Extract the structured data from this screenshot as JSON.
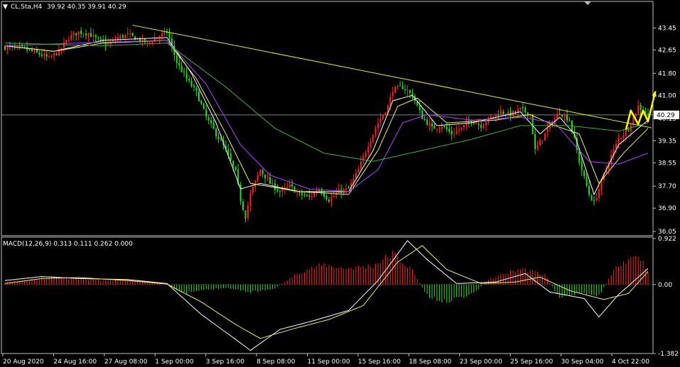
{
  "colors": {
    "background": "#000000",
    "frame": "#c0c0c0",
    "bull": "#ff2020",
    "bear": "#22dd22",
    "ma_fast": "#ffffff",
    "ma_mid": "#f0f060",
    "ma_slow": "#b040ff",
    "ma_long": "#40b040",
    "trendline": "#e8e830",
    "arrows": "#ffff00",
    "price_line": "#808080",
    "macd_line": "#ffffff",
    "signal_line": "#f0f060"
  },
  "chart_data": [
    {
      "type": "candlestick",
      "title": "CL.Sta,H4",
      "ohlc_header": "39.92 40.35 39.91 40.29",
      "ylim": [
        35.9,
        44.0
      ],
      "y_ticks": [
        "43.45",
        "42.65",
        "41.80",
        "41.00",
        "40.15",
        "39.35",
        "38.55",
        "37.70",
        "36.90",
        "36.05"
      ],
      "y_tick_values": [
        43.45,
        42.65,
        41.8,
        41.0,
        40.15,
        39.35,
        38.55,
        37.7,
        36.9,
        36.05
      ],
      "current_price": "40.29",
      "current_price_value": 40.29,
      "x_ticks": [
        "20 Aug 2020",
        "24 Aug 16:00",
        "27 Aug 08:00",
        "1 Sep 00:00",
        "3 Sep 16:00",
        "8 Sep 08:00",
        "11 Sep 00:00",
        "15 Sep 16:00",
        "18 Sep 08:00",
        "23 Sep 00:00",
        "25 Sep 16:00",
        "30 Sep 04:00",
        "4 Oct 22:00"
      ],
      "close_path": [
        [
          0,
          42.75
        ],
        [
          8,
          42.7
        ],
        [
          14,
          42.5
        ],
        [
          18,
          42.35
        ],
        [
          22,
          42.6
        ],
        [
          26,
          43.1
        ],
        [
          30,
          43.3
        ],
        [
          34,
          43.25
        ],
        [
          38,
          43.0
        ],
        [
          42,
          42.85
        ],
        [
          46,
          43.1
        ],
        [
          50,
          43.2
        ],
        [
          54,
          43.05
        ],
        [
          58,
          42.9
        ],
        [
          62,
          43.1
        ],
        [
          66,
          43.3
        ],
        [
          70,
          42.2
        ],
        [
          74,
          41.6
        ],
        [
          78,
          41.1
        ],
        [
          82,
          40.2
        ],
        [
          86,
          39.6
        ],
        [
          90,
          39.0
        ],
        [
          94,
          38.2
        ],
        [
          96,
          37.2
        ],
        [
          98,
          36.6
        ],
        [
          100,
          37.4
        ],
        [
          104,
          38.3
        ],
        [
          108,
          37.8
        ],
        [
          112,
          37.5
        ],
        [
          116,
          37.7
        ],
        [
          120,
          37.4
        ],
        [
          124,
          37.3
        ],
        [
          128,
          37.6
        ],
        [
          132,
          37.2
        ],
        [
          136,
          37.5
        ],
        [
          140,
          37.6
        ],
        [
          144,
          38.3
        ],
        [
          148,
          39.2
        ],
        [
          152,
          40.0
        ],
        [
          156,
          40.6
        ],
        [
          158,
          41.2
        ],
        [
          162,
          41.3
        ],
        [
          166,
          41.0
        ],
        [
          170,
          40.2
        ],
        [
          174,
          39.8
        ],
        [
          178,
          39.9
        ],
        [
          182,
          39.6
        ],
        [
          186,
          39.8
        ],
        [
          190,
          40.1
        ],
        [
          194,
          39.9
        ],
        [
          198,
          40.2
        ],
        [
          202,
          40.4
        ],
        [
          206,
          40.3
        ],
        [
          210,
          40.5
        ],
        [
          214,
          40.3
        ],
        [
          216,
          39.0
        ],
        [
          218,
          39.3
        ],
        [
          222,
          39.9
        ],
        [
          226,
          40.4
        ],
        [
          230,
          40.1
        ],
        [
          232,
          39.4
        ],
        [
          234,
          38.6
        ],
        [
          236,
          38.0
        ],
        [
          238,
          37.4
        ],
        [
          240,
          37.1
        ],
        [
          242,
          37.6
        ],
        [
          246,
          38.6
        ],
        [
          250,
          39.4
        ],
        [
          254,
          39.8
        ],
        [
          258,
          40.6
        ],
        [
          262,
          40.29
        ]
      ],
      "overlays": [
        {
          "name": "MA fast",
          "color": "#ffffff",
          "path": [
            [
              0,
              42.8
            ],
            [
              20,
              42.6
            ],
            [
              40,
              43.0
            ],
            [
              66,
              43.1
            ],
            [
              76,
              41.8
            ],
            [
              86,
              40.0
            ],
            [
              96,
              37.6
            ],
            [
              104,
              37.8
            ],
            [
              120,
              37.5
            ],
            [
              140,
              37.5
            ],
            [
              150,
              39.0
            ],
            [
              158,
              40.8
            ],
            [
              166,
              41.0
            ],
            [
              176,
              39.9
            ],
            [
              190,
              40.0
            ],
            [
              210,
              40.4
            ],
            [
              218,
              39.6
            ],
            [
              226,
              40.2
            ],
            [
              232,
              39.6
            ],
            [
              240,
              37.4
            ],
            [
              250,
              39.2
            ],
            [
              262,
              40.1
            ]
          ]
        },
        {
          "name": "MA mid",
          "color": "#f0f060",
          "path": [
            [
              0,
              42.8
            ],
            [
              20,
              42.6
            ],
            [
              40,
              42.9
            ],
            [
              66,
              43.0
            ],
            [
              78,
              41.6
            ],
            [
              90,
              39.6
            ],
            [
              100,
              37.8
            ],
            [
              120,
              37.5
            ],
            [
              140,
              37.4
            ],
            [
              152,
              39.0
            ],
            [
              160,
              40.6
            ],
            [
              168,
              40.9
            ],
            [
              180,
              40.0
            ],
            [
              200,
              40.1
            ],
            [
              214,
              40.3
            ],
            [
              224,
              39.9
            ],
            [
              234,
              39.6
            ],
            [
              242,
              37.8
            ],
            [
              252,
              38.9
            ],
            [
              262,
              39.8
            ]
          ]
        },
        {
          "name": "MA slow",
          "color": "#b040ff",
          "path": [
            [
              0,
              42.8
            ],
            [
              30,
              42.9
            ],
            [
              66,
              43.0
            ],
            [
              82,
              41.4
            ],
            [
              96,
              39.2
            ],
            [
              108,
              38.1
            ],
            [
              124,
              37.6
            ],
            [
              140,
              37.5
            ],
            [
              152,
              38.3
            ],
            [
              162,
              40.0
            ],
            [
              172,
              40.3
            ],
            [
              190,
              40.1
            ],
            [
              210,
              40.2
            ],
            [
              224,
              40.0
            ],
            [
              238,
              38.6
            ],
            [
              250,
              38.5
            ],
            [
              262,
              38.9
            ]
          ]
        },
        {
          "name": "MA long",
          "color": "#40b040",
          "path": [
            [
              0,
              42.9
            ],
            [
              40,
              42.8
            ],
            [
              66,
              42.9
            ],
            [
              90,
              41.3
            ],
            [
              110,
              39.8
            ],
            [
              130,
              38.9
            ],
            [
              150,
              38.6
            ],
            [
              170,
              39.0
            ],
            [
              190,
              39.4
            ],
            [
              210,
              39.9
            ],
            [
              230,
              39.9
            ],
            [
              250,
              39.7
            ],
            [
              262,
              40.0
            ]
          ]
        }
      ],
      "trendline": [
        [
          52,
          43.55
        ],
        [
          290,
          39.35
        ]
      ],
      "arrow_path": [
        [
          253,
          39.75
        ],
        [
          255,
          40.45
        ],
        [
          258,
          39.95
        ],
        [
          260,
          40.45
        ],
        [
          262,
          40.05
        ],
        [
          265,
          41.15
        ]
      ]
    },
    {
      "type": "bar",
      "title": "MACD(12,26,9) 0.313 0.111 0.262 0.000",
      "ylim": [
        -1.382,
        0.922
      ],
      "y_ticks": [
        "0.922",
        "0.00",
        "-1.382"
      ],
      "y_tick_values": [
        0.922,
        0.0,
        -1.382
      ],
      "histogram_path": [
        [
          0,
          0.05
        ],
        [
          10,
          0.1
        ],
        [
          20,
          0.16
        ],
        [
          30,
          0.12
        ],
        [
          40,
          0.08
        ],
        [
          50,
          0.1
        ],
        [
          66,
          0.02
        ],
        [
          72,
          -0.18
        ],
        [
          80,
          -0.12
        ],
        [
          90,
          -0.06
        ],
        [
          100,
          -0.15
        ],
        [
          110,
          -0.08
        ],
        [
          120,
          0.25
        ],
        [
          130,
          0.4
        ],
        [
          138,
          0.32
        ],
        [
          150,
          0.38
        ],
        [
          158,
          0.62
        ],
        [
          166,
          0.28
        ],
        [
          172,
          -0.22
        ],
        [
          178,
          -0.35
        ],
        [
          190,
          -0.2
        ],
        [
          198,
          0.12
        ],
        [
          210,
          0.32
        ],
        [
          220,
          0.2
        ],
        [
          226,
          -0.28
        ],
        [
          234,
          -0.15
        ],
        [
          242,
          -0.22
        ],
        [
          250,
          0.42
        ],
        [
          258,
          0.6
        ],
        [
          262,
          0.28
        ]
      ],
      "macd_path": [
        [
          0,
          0.08
        ],
        [
          15,
          0.16
        ],
        [
          30,
          0.12
        ],
        [
          50,
          0.1
        ],
        [
          66,
          0.02
        ],
        [
          80,
          -0.6
        ],
        [
          94,
          -1.1
        ],
        [
          100,
          -1.32
        ],
        [
          112,
          -0.9
        ],
        [
          126,
          -0.72
        ],
        [
          140,
          -0.52
        ],
        [
          152,
          0.08
        ],
        [
          164,
          0.88
        ],
        [
          172,
          0.5
        ],
        [
          184,
          0.02
        ],
        [
          200,
          0.05
        ],
        [
          212,
          0.22
        ],
        [
          222,
          -0.15
        ],
        [
          236,
          -0.28
        ],
        [
          242,
          -0.65
        ],
        [
          250,
          -0.2
        ],
        [
          262,
          0.32
        ]
      ],
      "signal_path": [
        [
          0,
          0.02
        ],
        [
          15,
          0.12
        ],
        [
          30,
          0.14
        ],
        [
          50,
          0.08
        ],
        [
          66,
          0.01
        ],
        [
          80,
          -0.35
        ],
        [
          94,
          -0.8
        ],
        [
          104,
          -1.08
        ],
        [
          118,
          -0.88
        ],
        [
          132,
          -0.7
        ],
        [
          146,
          -0.42
        ],
        [
          160,
          0.45
        ],
        [
          170,
          0.78
        ],
        [
          180,
          0.3
        ],
        [
          194,
          0.02
        ],
        [
          208,
          0.05
        ],
        [
          218,
          0.15
        ],
        [
          230,
          -0.12
        ],
        [
          244,
          -0.3
        ],
        [
          254,
          -0.18
        ],
        [
          262,
          0.26
        ]
      ]
    }
  ]
}
